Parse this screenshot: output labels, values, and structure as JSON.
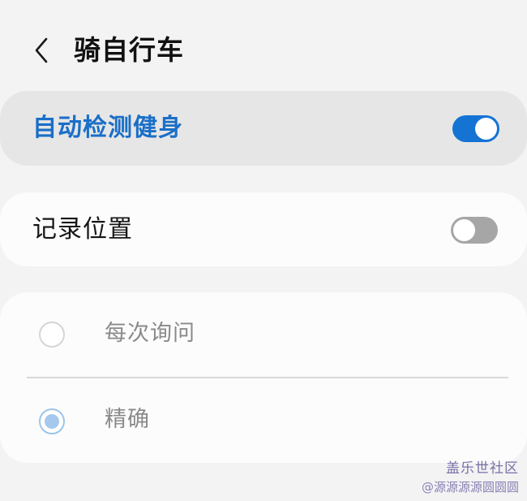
{
  "header": {
    "title": "骑自行车"
  },
  "settings": {
    "auto_detect": {
      "label": "自动检测健身",
      "enabled": true
    },
    "record_location": {
      "label": "记录位置",
      "enabled": false
    },
    "location_mode": {
      "options": [
        {
          "label": "每次询问",
          "selected": false
        },
        {
          "label": "精确",
          "selected": true
        }
      ]
    }
  },
  "watermark": {
    "brand": "盖乐世社区",
    "user": "@源源源源圆圆圆"
  },
  "colors": {
    "accent": "#1573d4",
    "accent_text": "#1a6fc8",
    "background": "#f3f3f3",
    "toggle_off": "#a6a6a6"
  }
}
